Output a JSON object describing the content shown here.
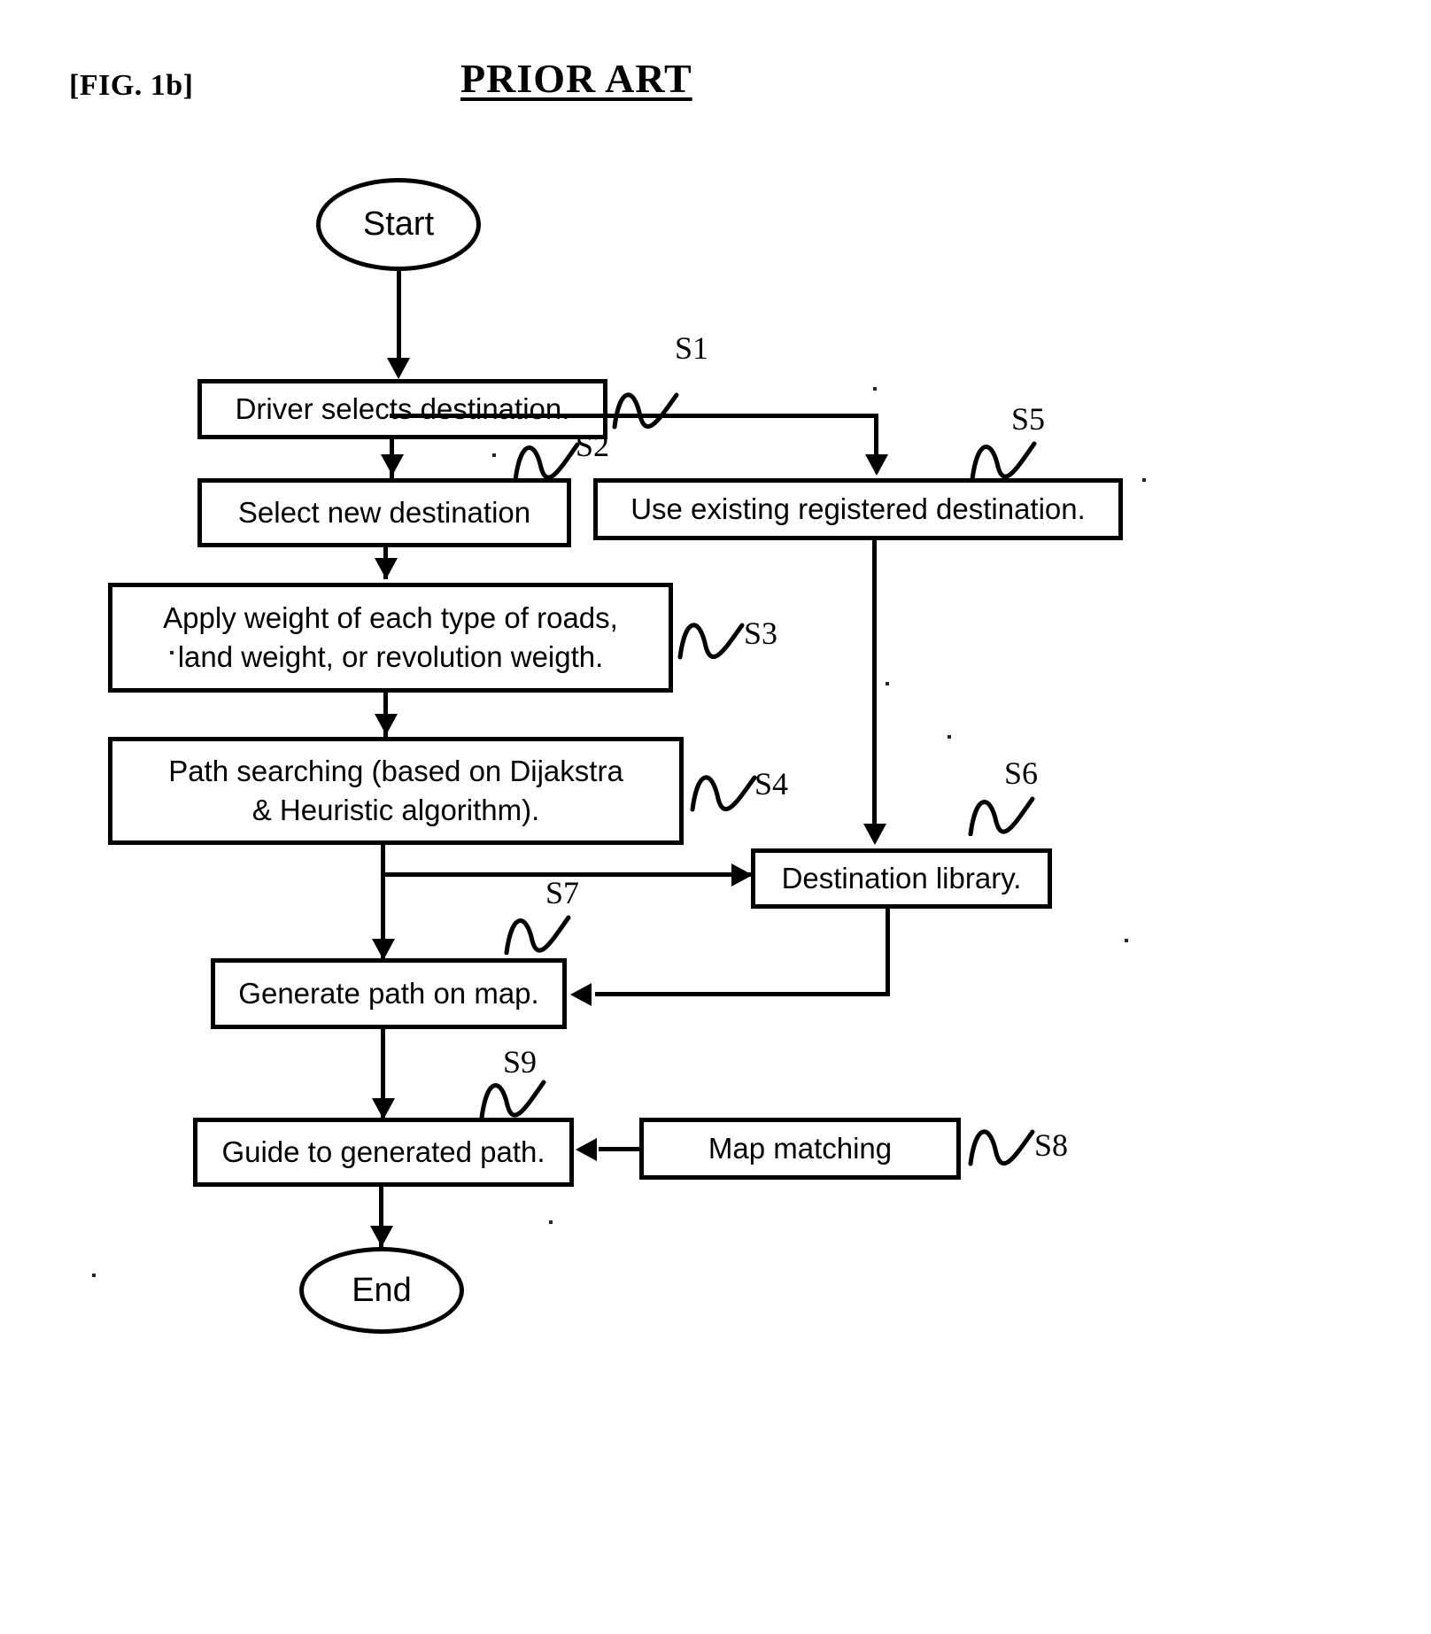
{
  "figure": {
    "label": "[FIG. 1b]",
    "title": "PRIOR ART"
  },
  "flowchart": {
    "type": "flowchart",
    "nodes": [
      {
        "id": "start",
        "shape": "ellipse",
        "text": "Start",
        "step": ""
      },
      {
        "id": "s1",
        "shape": "process",
        "text": "Driver selects destination.",
        "step": "S1"
      },
      {
        "id": "s2",
        "shape": "process",
        "text": "Select new destination",
        "step": "S2"
      },
      {
        "id": "s5",
        "shape": "process",
        "text": "Use existing registered destination.",
        "step": "S5"
      },
      {
        "id": "s3",
        "shape": "process",
        "line1": "Apply weight of each type of roads,",
        "line2": "land weight, or revolution weigth.",
        "step": "S3"
      },
      {
        "id": "s4",
        "shape": "process",
        "line1": "Path searching (based on Dijakstra",
        "line2": "& Heuristic algorithm).",
        "step": "S4"
      },
      {
        "id": "s6",
        "shape": "process",
        "text": "Destination library.",
        "step": "S6"
      },
      {
        "id": "s7",
        "shape": "process",
        "text": "Generate path on map.",
        "step": "S7"
      },
      {
        "id": "s9",
        "shape": "process",
        "text": "Guide to generated path.",
        "step": "S9"
      },
      {
        "id": "s8",
        "shape": "process",
        "text": "Map matching",
        "step": "S8"
      },
      {
        "id": "end",
        "shape": "ellipse",
        "text": "End",
        "step": ""
      }
    ],
    "edges": [
      {
        "from": "start",
        "to": "s1"
      },
      {
        "from": "s1",
        "to": "s2"
      },
      {
        "from": "s1",
        "to": "s5"
      },
      {
        "from": "s2",
        "to": "s3"
      },
      {
        "from": "s3",
        "to": "s4"
      },
      {
        "from": "s4",
        "to": "s7"
      },
      {
        "from": "s4",
        "to": "s6"
      },
      {
        "from": "s5",
        "to": "s6"
      },
      {
        "from": "s6",
        "to": "s7"
      },
      {
        "from": "s7",
        "to": "s9"
      },
      {
        "from": "s8",
        "to": "s9"
      },
      {
        "from": "s9",
        "to": "end"
      }
    ],
    "colors": {
      "stroke": "#000000",
      "background": "#ffffff"
    }
  }
}
